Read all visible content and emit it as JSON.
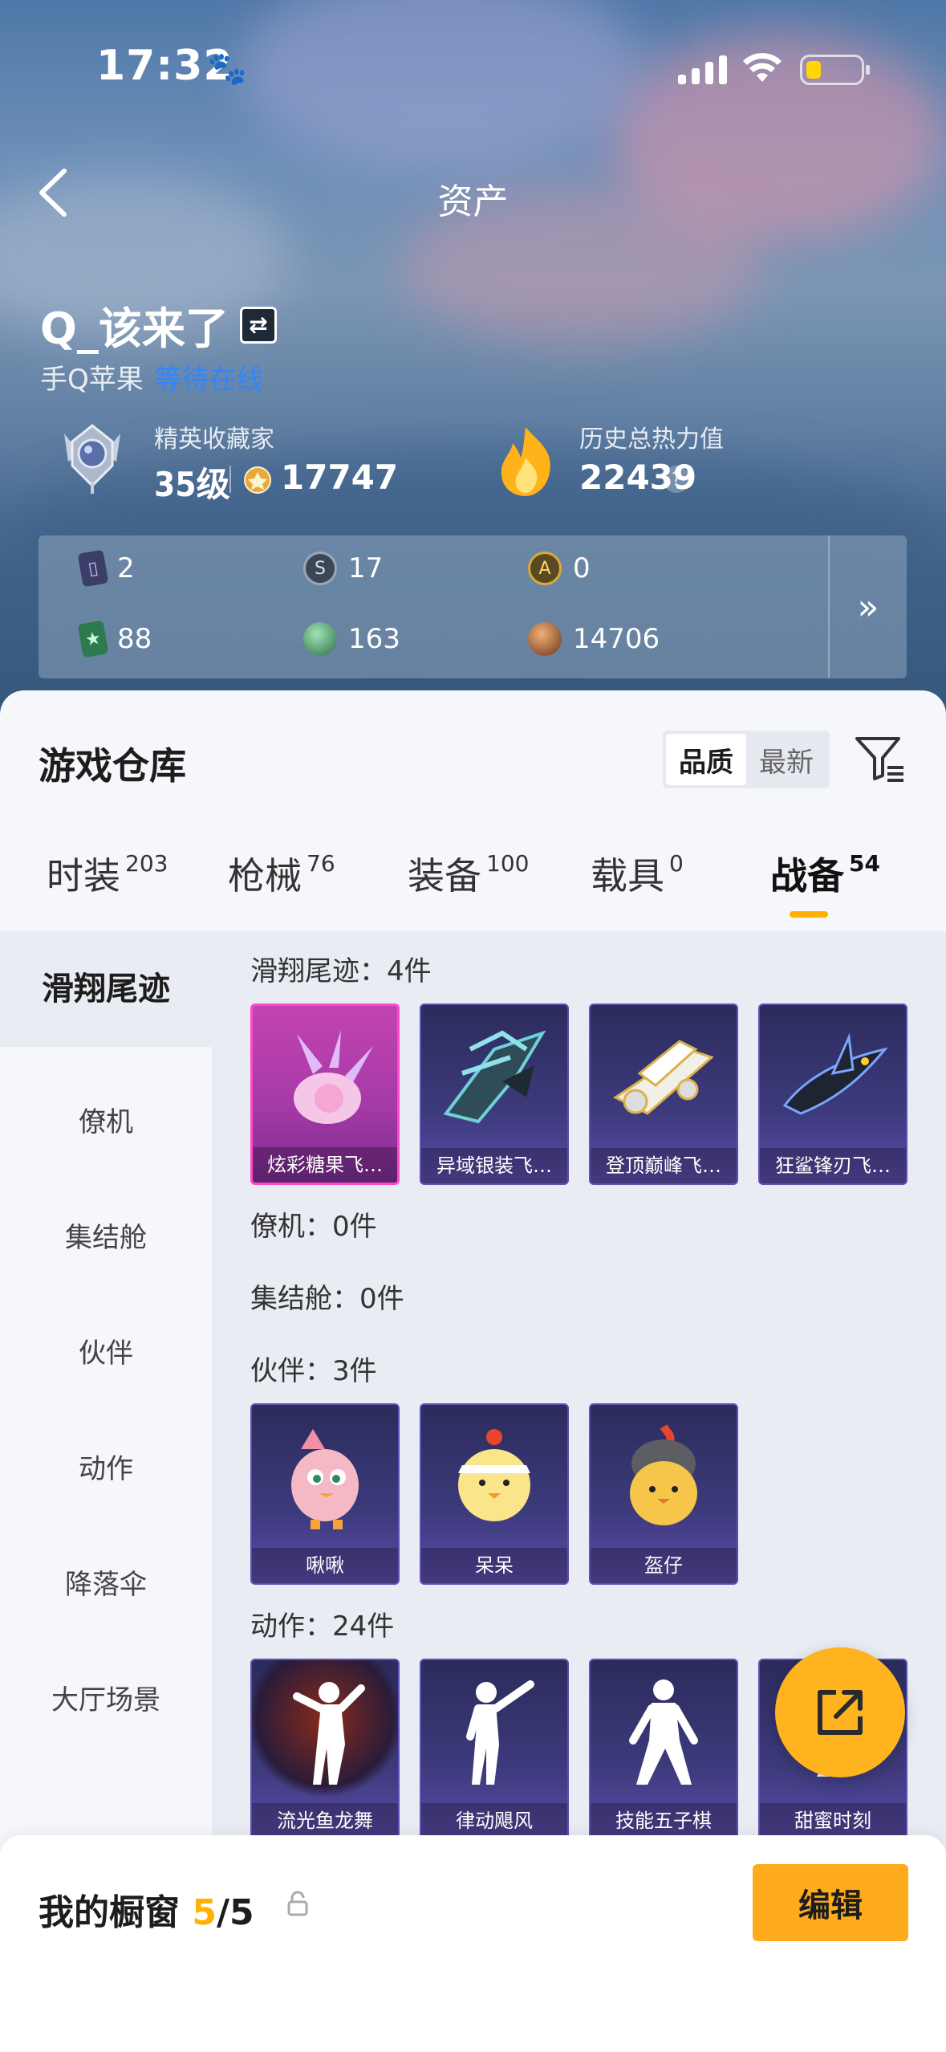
{
  "status_bar": {
    "time": "17:32"
  },
  "header": {
    "title": "资产"
  },
  "profile": {
    "username": "Q_该来了",
    "platform": "手Q苹果",
    "online_status": "等待在线",
    "rank_title": "精英收藏家",
    "rank_level": "35级",
    "rank_points": "17747",
    "heat_title": "历史总热力值",
    "heat_value": "22439"
  },
  "currencies": [
    {
      "icon": "purple-card-icon",
      "value": "2"
    },
    {
      "icon": "silver-coin-icon",
      "value": "17"
    },
    {
      "icon": "gold-coin-icon",
      "value": "0"
    },
    {
      "icon": "green-card-icon",
      "value": "88"
    },
    {
      "icon": "green-orb-icon",
      "value": "163"
    },
    {
      "icon": "bronze-orb-icon",
      "value": "14706"
    }
  ],
  "warehouse": {
    "title": "游戏仓库",
    "sort_options": [
      "品质",
      "最新"
    ],
    "sort_selected": "品质"
  },
  "tabs": [
    {
      "label": "时装",
      "count": "203"
    },
    {
      "label": "枪械",
      "count": "76"
    },
    {
      "label": "装备",
      "count": "100"
    },
    {
      "label": "载具",
      "count": "0"
    },
    {
      "label": "战备",
      "count": "54",
      "active": true
    }
  ],
  "sidebar": [
    {
      "label": "滑翔尾迹",
      "active": true
    },
    {
      "label": "僚机"
    },
    {
      "label": "集结舱"
    },
    {
      "label": "伙伴"
    },
    {
      "label": "动作"
    },
    {
      "label": "降落伞"
    },
    {
      "label": "大厅场景"
    }
  ],
  "sections": {
    "trail": {
      "label": "滑翔尾迹：4件",
      "items": [
        "炫彩糖果飞…",
        "异域银装飞…",
        "登顶巅峰飞…",
        "狂鲨锋刃飞…"
      ]
    },
    "wingman": {
      "label": "僚机：0件"
    },
    "capsule": {
      "label": "集结舱：0件"
    },
    "partner": {
      "label": "伙伴：3件",
      "items": [
        "啾啾",
        "呆呆",
        "盔仔"
      ]
    },
    "emote": {
      "label": "动作：24件",
      "items": [
        "流光鱼龙舞",
        "律动飓风",
        "技能五子棋",
        "甜蜜时刻"
      ]
    }
  },
  "showcase": {
    "label": "我的橱窗",
    "count_current": "5",
    "count_total": "/5",
    "edit_label": "编辑"
  },
  "colors": {
    "accent": "#ffb000",
    "link_blue": "#2f86ff",
    "card_purple": "#3d3a7c",
    "card_pink": "#c344b0"
  }
}
